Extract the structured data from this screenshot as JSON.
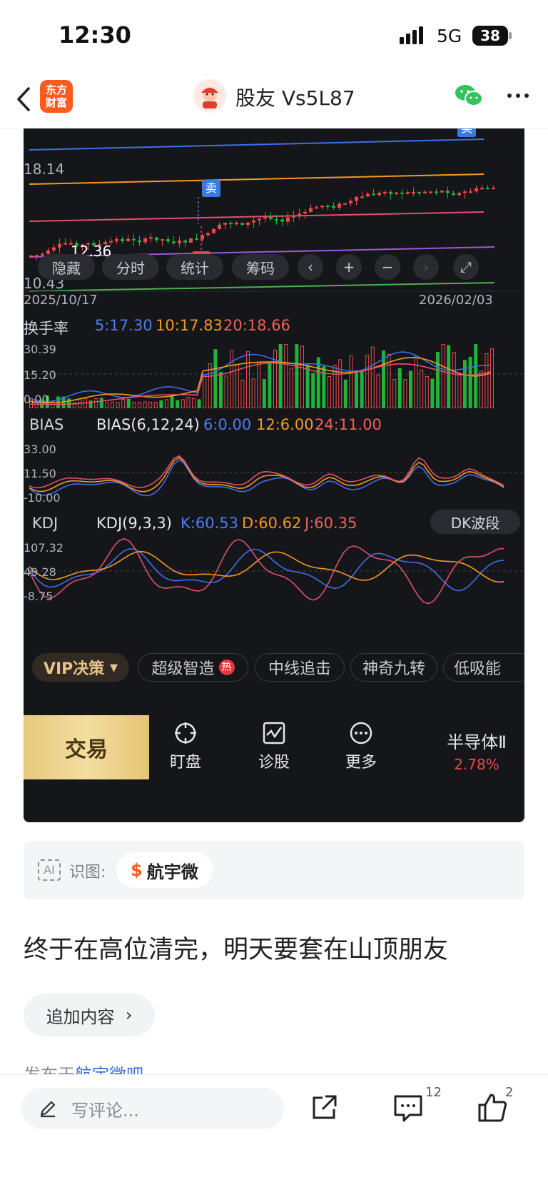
{
  "status_bar": {
    "time": "12:30",
    "network": "5G",
    "battery": "38"
  },
  "nav": {
    "logo_text_line1": "东方",
    "logo_text_line2": "财富",
    "title": "股友 Vs5L87",
    "wechat_icon": "wechat-icon",
    "more_icon": "more-icon"
  },
  "chart": {
    "price_labels": [
      "18.14",
      "12.36",
      "10.43"
    ],
    "sell_label": "卖",
    "buy_label": "买",
    "chips": [
      "隐藏",
      "分时",
      "统计",
      "筹码"
    ],
    "date_start": "2025/10/17",
    "date_end": "2026/02/03",
    "turnover": {
      "name": "换手率",
      "ma5": "5:17.30",
      "ma10": "10:17.83",
      "ma20": "20:18.66",
      "levels": [
        "30.39",
        "15.20",
        "0.00"
      ]
    },
    "bias": {
      "name": "BIAS",
      "params": "BIAS(6,12,24)",
      "v6": "6:0.00",
      "v12": "12:6.00",
      "v24": "24:11.00",
      "levels": [
        "33.00",
        "11.50",
        "-10.00"
      ]
    },
    "kdj": {
      "name": "KDJ",
      "params": "KDJ(9,3,3)",
      "k": "K:60.53",
      "d": "D:60.62",
      "j": "J:60.35",
      "badge": "DK波段",
      "levels": [
        "107.32",
        "49.28",
        "-8.75"
      ]
    },
    "colors": {
      "up": "#f0484a",
      "down": "#1fb33a",
      "blue": "#3f6ee8",
      "orange": "#f29a1e",
      "pink": "#e0506b",
      "purple": "#9b59d6",
      "green": "#4caf50"
    }
  },
  "strategy_tabs": {
    "vip": "VIP决策",
    "items": [
      "超级智造",
      "中线追击",
      "神奇九转",
      "低吸能"
    ],
    "hot": "热"
  },
  "trade_bar": {
    "trade": "交易",
    "tools": [
      "盯盘",
      "诊股",
      "更多"
    ],
    "sector_name": "半导体Ⅱ",
    "sector_pct": "2.78%"
  },
  "recognition": {
    "ai": "AI",
    "label": "识图:",
    "stock": "航宇微"
  },
  "post": {
    "text": "终于在高位清完，明天要套在山顶朋友",
    "append": "追加内容",
    "published_prefix": "发布于",
    "bar_name": "航宇微吧"
  },
  "bottom_bar": {
    "comment_placeholder": "写评论...",
    "comment_count": "12",
    "like_count": "2"
  }
}
